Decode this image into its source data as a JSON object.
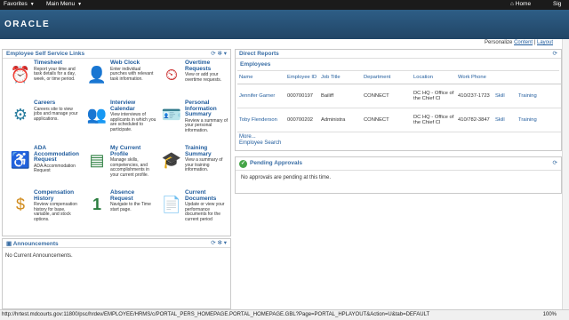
{
  "topbar": {
    "favorites": "Favorites",
    "main_menu": "Main Menu",
    "home": "Home",
    "sign": "Sig"
  },
  "brand": {
    "logo": "ORACLE"
  },
  "personalize": {
    "label": "Personalize",
    "content": "Content",
    "sep": "|",
    "layout": "Layout"
  },
  "ess": {
    "title": "Employee Self Service Links",
    "tools": "⟳  ✻ ▾",
    "tiles": [
      {
        "title": "Timesheet",
        "desc": "Report your time and task details for a day, week, or time period."
      },
      {
        "title": "Web Clock",
        "desc": "Enter individual punches with relevant task information."
      },
      {
        "title": "Overtime Requests",
        "desc": "View or add your overtime requests."
      },
      {
        "title": "Careers",
        "desc": "Careers site to view jobs and manage your applications."
      },
      {
        "title": "Interview Calendar",
        "desc": "View interviews of applicants in which you are scheduled to participate."
      },
      {
        "title": "Personal Information Summary",
        "desc": "Review a summary of your personal information."
      },
      {
        "title": "ADA Accommodation Request",
        "desc": "ADA Accommodation Request"
      },
      {
        "title": "My Current Profile",
        "desc": "Manage skills, competencies, and accomplishments in your current profile."
      },
      {
        "title": "Training Summary",
        "desc": "View a summary of your training information."
      },
      {
        "title": "Compensation History",
        "desc": "Review compensation history for base, variable, and stock options."
      },
      {
        "title": "Absence Request",
        "desc": "Navigate to the Time start page."
      },
      {
        "title": "Current Documents",
        "desc": "Update or view your performance documents for the current period"
      }
    ]
  },
  "announcements": {
    "title": "Announcements",
    "tools": "⟳  ✻ ▾",
    "body": "No Current Announcements."
  },
  "direct_reports": {
    "title": "Direct Reports",
    "tools": "⟳",
    "sub": "Employees",
    "columns": [
      "Name",
      "Employee ID",
      "Job Title",
      "Department",
      "Location",
      "Work Phone",
      "",
      ""
    ],
    "rows": [
      [
        "Jennifer Garner",
        "000700197",
        "Bailiff",
        "CONNECT",
        "DC HQ - Office of the Chief Cl",
        "410/237-1723",
        "Skill",
        "Training"
      ],
      [
        "Toby Flenderson",
        "000700202",
        "Administra",
        "CONNECT",
        "DC HQ - Office of the Chief Cl",
        "410/782-3847",
        "Skill",
        "Training"
      ]
    ],
    "more": "More...",
    "search": "Employee Search"
  },
  "pending": {
    "title": "Pending Approvals",
    "tools": "⟳",
    "body": "No approvals are pending at this time."
  },
  "status": {
    "url": "http://hrtest.mdcourts.gov:11800/psc/hrdev/EMPLOYEE/HRMS/c/PORTAL_PERS_HOMEPAGE.PORTAL_HOMEPAGE.GBL?Page=PORTAL_HPLAYOUT&Action=U&tab=DEFAULT",
    "zoom": "100%"
  }
}
